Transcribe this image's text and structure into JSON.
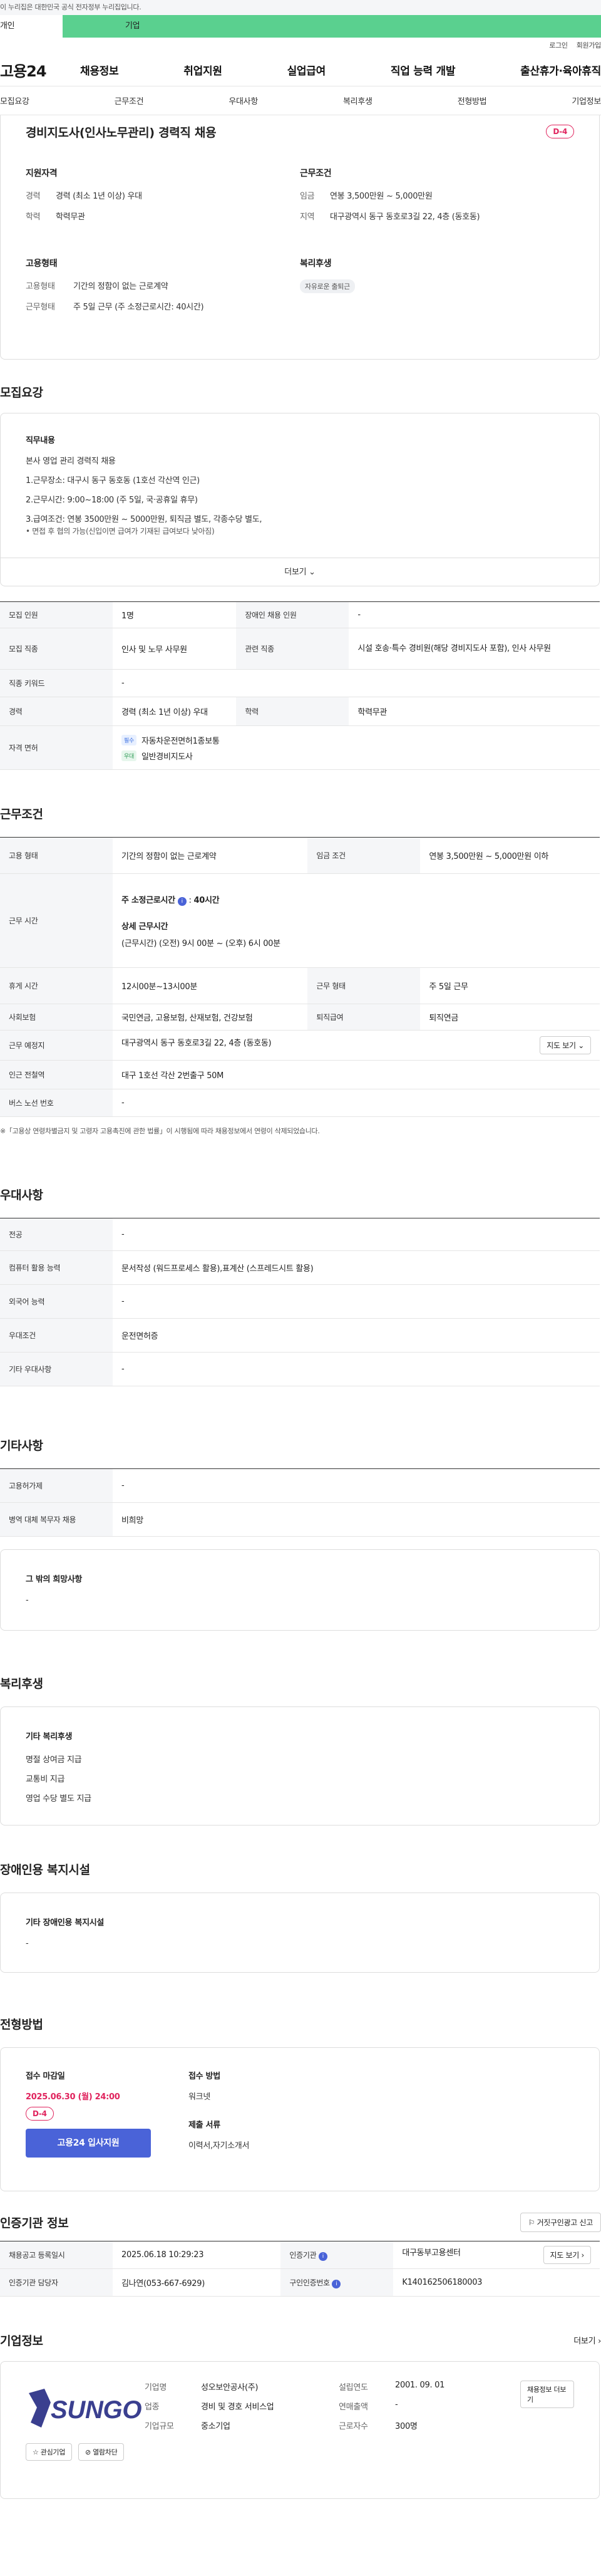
{
  "topbar": {
    "notice": "이 누리집은 대한민국 공식 전자정부 누리집입니다."
  },
  "user_tabs": {
    "personal": "개인",
    "business": "기업"
  },
  "header": {
    "login": "로그인",
    "signup": "회원가입",
    "logo": "고용24",
    "nav": [
      "채용정보",
      "취업지원",
      "실업급여",
      "직업 능력 개발",
      "출산휴가·육아휴직"
    ]
  },
  "subnav": [
    "모집요강",
    "근무조건",
    "우대사항",
    "복리후생",
    "전형방법",
    "기업정보"
  ],
  "job": {
    "title": "경비지도사(인사노무관리) 경력직 채용",
    "dday": "D-4"
  },
  "summary": {
    "qual_title": "지원자격",
    "career_k": "경력",
    "career_v": "경력 (최소 1년 이상) 우대",
    "edu_k": "학력",
    "edu_v": "학력무관",
    "cond_title": "근무조건",
    "wage_k": "임금",
    "wage_v": "연봉 3,500만원 ~ 5,000만원",
    "loc_k": "지역",
    "loc_v": "대구광역시 동구 동호로3길 22, 4층 (동호동)",
    "emp_title": "고용형태",
    "emptype_k": "고용형태",
    "emptype_v": "기간의 정함이 없는 근로계약",
    "worktype_k": "근무형태",
    "worktype_v": "주 5일 근무 (주 소정근로시간: 40시간)",
    "welfare_title": "복리후생",
    "welfare_tag": "자유로운 출퇴근"
  },
  "recruit": {
    "heading": "모집요강",
    "duty_title": "직무내용",
    "lines": [
      "본사 영업 관리 경력직 채용",
      "1.근무장소: 대구시 동구 동호동 (1호선 각산역 인근)",
      "2.근무시간: 9:00~18:00 (주 5일, 국·공휴일 휴무)",
      "3.급여조건: 연봉 3500만원 ~ 5000만원, 퇴직금 별도, 각종수당 별도,",
      "• 면접 후 협의 가능(신입이면 급여가 기재된 급여보다 낮아짐)"
    ],
    "more": "더보기"
  },
  "recruit_table": {
    "count_k": "모집 인원",
    "count_v": "1명",
    "disabled_k": "장애인 채용 인원",
    "disabled_v": "-",
    "job_k": "모집 직종",
    "job_v": "인사 및 노무 사무원",
    "related_k": "관련 직종",
    "related_v": "시설 호송·특수 경비원(해당 경비지도사 포함), 인사 사무원",
    "keyword_k": "직종 키워드",
    "keyword_v": "-",
    "career_k": "경력",
    "career_v": "경력 (최소 1년 이상) 우대",
    "edu_k": "학력",
    "edu_v": "학력무관",
    "license_k": "자격 면허",
    "lic1_tag": "필수",
    "lic1": "자동차운전면허1종보통",
    "lic2_tag": "우대",
    "lic2": "일반경비지도사"
  },
  "work": {
    "heading": "근무조건",
    "type_k": "고용 형태",
    "type_v": "기간의 정함이 없는 근로계약",
    "wage_k": "임금 조건",
    "wage_v": "연봉 3,500만원 ~ 5,000만원 이하",
    "hours_k": "근무 시간",
    "hours_std": "주 소정근로시간",
    "hours_std_v": "40시간",
    "hours_detail_t": "상세 근무시간",
    "hours_detail_v": "(근무시간) (오전) 9시 00분 ~ (오후) 6시 00분",
    "rest_k": "휴게 시간",
    "rest_v": "12시00분~13시00분",
    "shape_k": "근무 형태",
    "shape_v": "주 5일 근무",
    "ins_k": "사회보험",
    "ins_v": "국민연금, 고용보험, 산재보험, 건강보험",
    "retire_k": "퇴직급여",
    "retire_v": "퇴직연금",
    "place_k": "근무 예정지",
    "place_v": "대구광역시 동구 동호로3길 22, 4층 (동호동)",
    "map_btn": "지도 보기",
    "station_k": "인근 전철역",
    "station_v": "대구 1호선 각산 2번출구 50M",
    "bus_k": "버스 노선 번호",
    "bus_v": "-",
    "note": "※「고용상 연령차별금지 및 고령자 고용촉진에 관한 법률」이 시행됨에 따라 채용정보에서 연령이 삭제되었습니다."
  },
  "pref": {
    "heading": "우대사항",
    "major_k": "전공",
    "major_v": "-",
    "pc_k": "컴퓨터 활용 능력",
    "pc_v": "문서작성 (워드프로세스 활용),표계산 (스프레드시트 활용)",
    "lang_k": "외국어 능력",
    "lang_v": "-",
    "cond_k": "우대조건",
    "cond_v": "운전면허증",
    "etc_k": "기타 우대사항",
    "etc_v": "-"
  },
  "other": {
    "heading": "기타사항",
    "emp_k": "고용허가제",
    "emp_v": "-",
    "mil_k": "병역 대체 복무자 채용",
    "mil_v": "비희망",
    "wish_title": "그 밖의 희망사항",
    "wish_v": "-"
  },
  "welfare": {
    "heading": "복리후생",
    "title": "기타 복리후생",
    "items": [
      "명절 상여금 지급",
      "교통비 지급",
      "영업 수당 별도 지급"
    ]
  },
  "facility": {
    "heading": "장애인용 복지시설",
    "title": "기타 장애인용 복지시설",
    "v": "-"
  },
  "process": {
    "heading": "전형방법",
    "deadline_t": "접수 마감일",
    "deadline_v": "2025.06.30 (월) 24:00",
    "dday": "D-4",
    "apply_btn": "고용24 입사지원",
    "method_t": "접수 방법",
    "method_v": "워크넷",
    "docs_t": "제출 서류",
    "docs_v": "이력서,자기소개서"
  },
  "cert": {
    "heading": "인증기관 정보",
    "report_btn": "거짓구인광고 신고",
    "reg_k": "채용공고 등록일시",
    "reg_v": "2025.06.18 10:29:23",
    "org_k": "인증기관",
    "org_v": "대구동부고용센터",
    "map_btn": "지도 보기",
    "mgr_k": "인증기관 담당자",
    "mgr_v": "김나연(053-667-6929)",
    "no_k": "구인인증번호",
    "no_v": "K140162506180003"
  },
  "company": {
    "heading": "기업정보",
    "more": "더보기",
    "logo_text": "SUNGO",
    "fav_btn": "관심기업",
    "block_btn": "열람차단",
    "name_k": "기업명",
    "name_v": "성오보안공사(주)",
    "est_k": "설립연도",
    "est_v": "2001. 09. 01",
    "list_btn": "채용정보 더보기",
    "ind_k": "업종",
    "ind_v": "경비 및 경호 서비스업",
    "sales_k": "연매출액",
    "sales_v": "-",
    "size_k": "기업규모",
    "size_v": "중소기업",
    "emp_k": "근로자수",
    "emp_v": "300명"
  }
}
